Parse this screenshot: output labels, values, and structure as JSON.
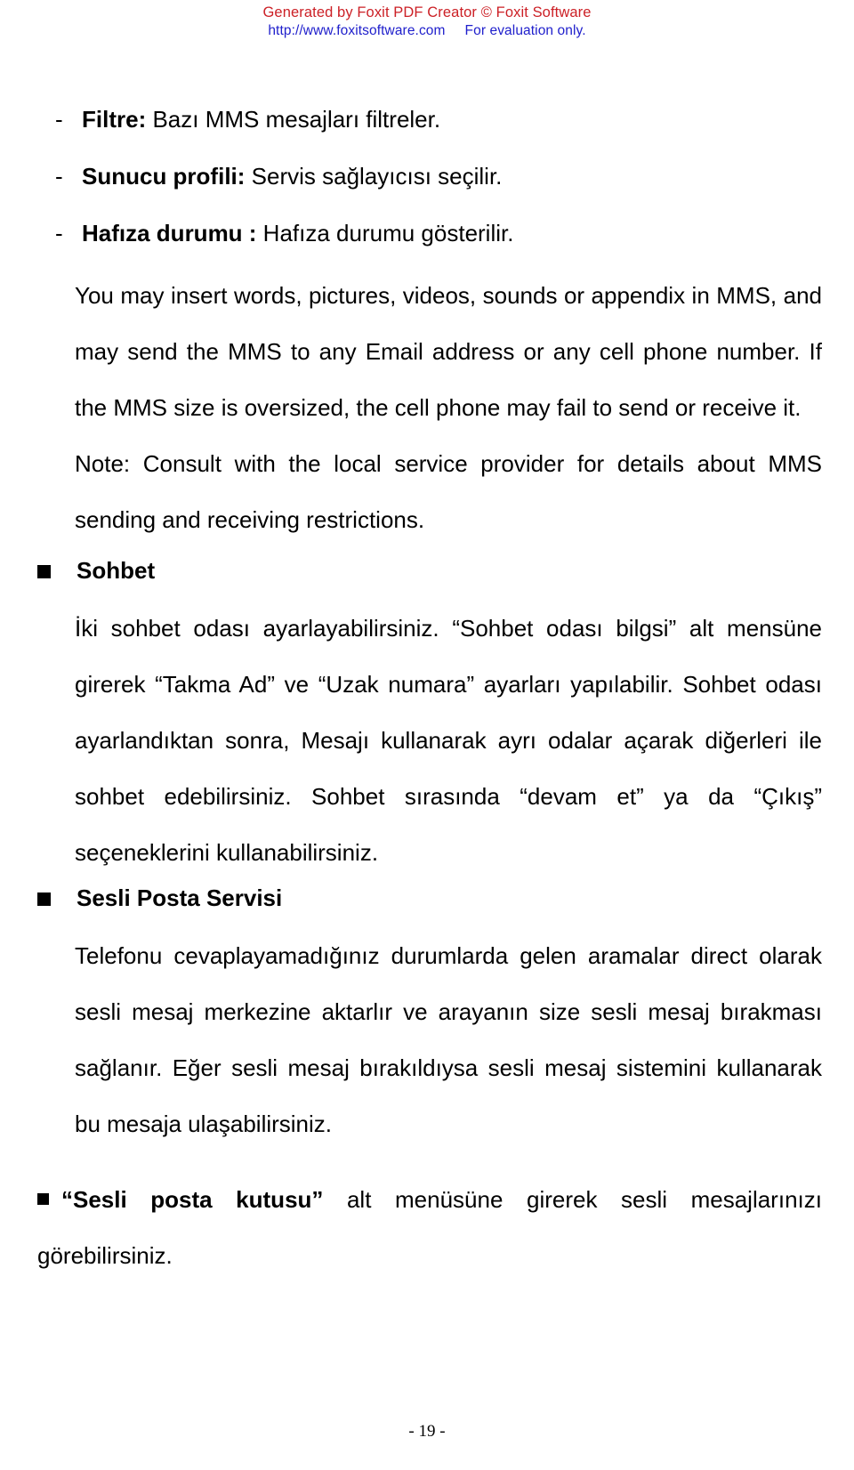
{
  "watermark": {
    "line1": "Generated by Foxit PDF Creator © Foxit Software",
    "line2_url": "http://www.foxitsoftware.com",
    "line2_note": "For evaluation only.",
    "color_red": "#cc2026",
    "color_blue": "#2020cc"
  },
  "bullets": [
    {
      "marker": "-",
      "label": "Filtre:",
      "text": " Bazı MMS mesajları filtreler."
    },
    {
      "marker": "-",
      "label": "Sunucu profili:",
      "text": " Servis sağlayıcısı seçilir."
    },
    {
      "marker": "-",
      "label": "Hafıza durumu :",
      "text": " Hafıza durumu gösterilir."
    }
  ],
  "paragraphs": {
    "mms_body": "You may insert words, pictures, videos, sounds or appendix in MMS, and may send the MMS to any Email address or any cell phone number. If the MMS size is oversized, the cell phone may fail to send or receive it.",
    "mms_note": "Note: Consult with the local service provider for details about MMS sending and receiving restrictions.",
    "sohbet_body": "İki sohbet odası ayarlayabilirsiniz. “Sohbet odası bilgsi” alt mensüne girerek “Takma Ad” ve “Uzak numara” ayarları yapılabilir. Sohbet odası ayarlandıktan sonra, Mesajı kullanarak ayrı odalar açarak diğerleri ile sohbet edebilirsiniz. Sohbet sırasında “devam et” ya da “Çıkış” seçeneklerini kullanabilirsiniz.",
    "sesli_body": "Telefonu cevaplayamadığınız durumlarda gelen aramalar direct olarak sesli mesaj merkezine aktarlır ve arayanın size sesli mesaj bırakması sağlanır. Eğer sesli mesaj bırakıldıysa sesli mesaj sistemini kullanarak bu mesaja ulaşabilirsiniz."
  },
  "headings": {
    "sohbet": "Sohbet",
    "sesli_posta_servisi": "Sesli Posta Servisi"
  },
  "final_bullet": {
    "quoted_bold": "“Sesli posta kutusu”",
    "rest": " alt menüsüne girerek sesli mesajlarınızı görebilirsiniz."
  },
  "footer": {
    "page_number": "- 19 -"
  }
}
